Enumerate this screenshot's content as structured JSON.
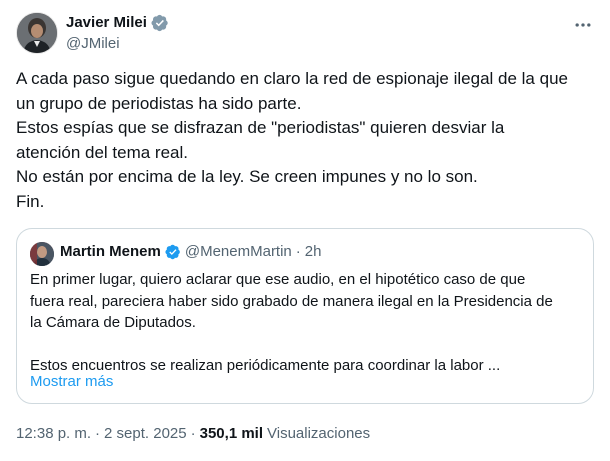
{
  "author": {
    "display_name": "Javier Milei",
    "handle": "@JMilei",
    "verified_color": "#829aab"
  },
  "tweet": {
    "lines": [
      "A cada paso sigue quedando en claro la red de espionaje ilegal de la que",
      "un grupo de periodistas ha sido parte.",
      "Estos espías que se disfrazan de \"periodistas\" quieren desviar la",
      "atención del tema real.",
      "No están por encima de la ley. Se creen impunes y no lo son.",
      "Fin."
    ]
  },
  "quote": {
    "display_name": "Martin Menem",
    "handle": "@MenemMartin",
    "separator": "·",
    "time": "2h",
    "verified_color": "#1d9bf0",
    "lines": [
      "En primer lugar, quiero aclarar que ese audio, en el hipotético caso de que",
      "fuera real, pareciera haber sido grabado de manera ilegal en la Presidencia de",
      "la Cámara de Diputados.",
      "",
      "Estos encuentros se realizan periódicamente para coordinar la labor ..."
    ],
    "show_more": "Mostrar más"
  },
  "meta": {
    "time": "12:38 p. m.",
    "date": "2 sept. 2025",
    "separator": "·",
    "views_count": "350,1 mil",
    "views_label": "Visualizaciones"
  },
  "colors": {
    "text": "#0f1419",
    "secondary": "#536471",
    "link": "#1d9bf0",
    "border": "#cfd9de"
  },
  "icons": {
    "more": "more-horizontal-icon",
    "verified_gray": "verified-badge-gray-icon",
    "verified_blue": "verified-badge-blue-icon"
  }
}
